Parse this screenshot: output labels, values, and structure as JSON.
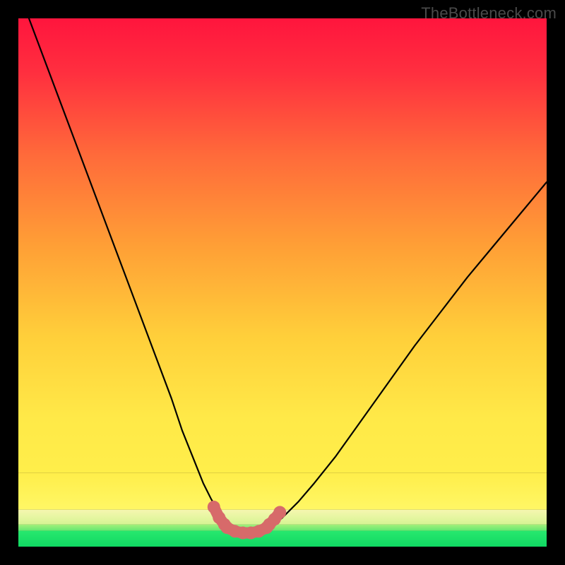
{
  "watermark": "TheBottleneck.com",
  "chart_data": {
    "type": "line",
    "title": "",
    "xlabel": "",
    "ylabel": "",
    "xlim": [
      0,
      100
    ],
    "ylim": [
      0,
      100
    ],
    "series": [
      {
        "name": "curve",
        "x": [
          2,
          5,
          8,
          11,
          14,
          17,
          20,
          23,
          26,
          29,
          31,
          33,
          35,
          36.5,
          38,
          39,
          40,
          41,
          42,
          43,
          44,
          45,
          46,
          47,
          48,
          50,
          53,
          56,
          60,
          65,
          70,
          75,
          80,
          85,
          90,
          95,
          100
        ],
        "values": [
          100,
          92,
          84,
          76,
          68,
          60,
          52,
          44,
          36,
          28,
          22,
          17,
          12,
          9,
          6.5,
          5,
          3.8,
          3,
          2.4,
          2.1,
          2,
          2.1,
          2.4,
          3,
          3.8,
          5.5,
          8.5,
          12,
          17,
          24,
          31,
          38,
          44.5,
          51,
          57,
          63,
          69
        ]
      },
      {
        "name": "highlight-left",
        "x": [
          37,
          38,
          39
        ],
        "values": [
          7.5,
          5.5,
          4.2
        ]
      },
      {
        "name": "highlight-bottom",
        "x": [
          39.5,
          41,
          42.5,
          44,
          45.5,
          47
        ],
        "values": [
          3.6,
          2.9,
          2.6,
          2.6,
          2.9,
          3.6
        ]
      },
      {
        "name": "highlight-right",
        "x": [
          47.5,
          48.5,
          49.5
        ],
        "values": [
          4.2,
          5.2,
          6.5
        ]
      }
    ],
    "layers": [
      {
        "name": "band-base",
        "y0": 0,
        "y1": 3.0,
        "colorTop": "#27e86e",
        "colorBottom": "#10d862"
      },
      {
        "name": "band-mid1",
        "y0": 3.0,
        "y1": 4.2,
        "colorTop": "#a4f07a",
        "colorBottom": "#63e871"
      },
      {
        "name": "band-mid2",
        "y0": 4.2,
        "y1": 7.0,
        "colorTop": "#f6f7b0",
        "colorBottom": "#d6f493"
      },
      {
        "name": "band-mid3",
        "y0": 7.0,
        "y1": 14,
        "colorTop": "#ffee4a",
        "colorBottom": "#fff765"
      },
      {
        "name": "gradient-top",
        "y0": 14,
        "y1": 100,
        "gradient": true
      }
    ]
  }
}
